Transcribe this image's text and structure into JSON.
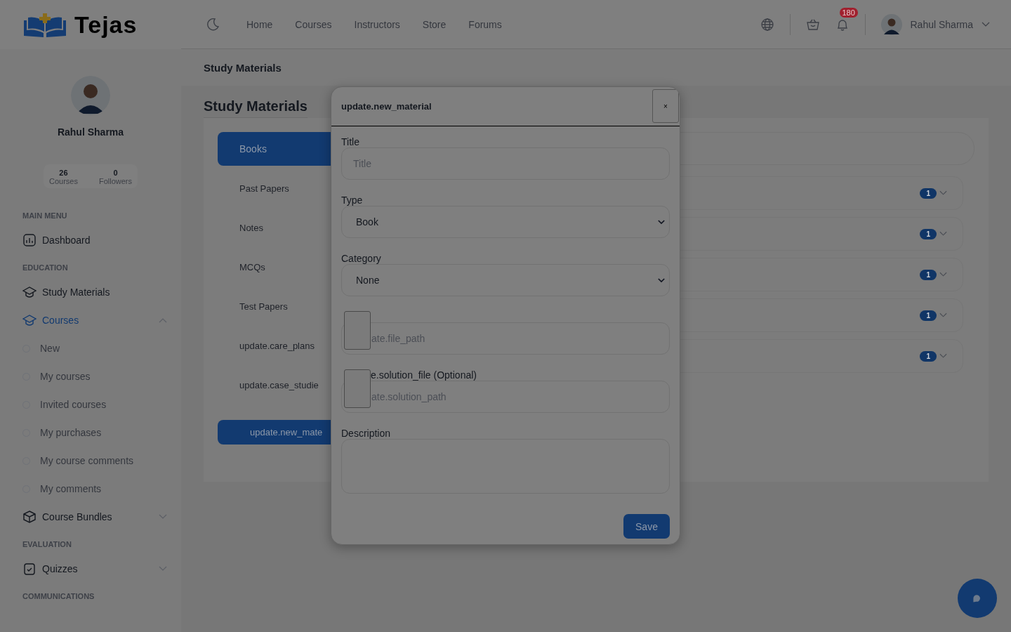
{
  "brand": {
    "name": "Tejas"
  },
  "nav": [
    {
      "label": "Home"
    },
    {
      "label": "Courses"
    },
    {
      "label": "Instructors"
    },
    {
      "label": "Store"
    },
    {
      "label": "Forums"
    }
  ],
  "header": {
    "notification_count": "180",
    "user_name": "Rahul Sharma"
  },
  "profile": {
    "name": "Rahul Sharma",
    "stats": [
      {
        "value": "26",
        "label": "Courses"
      },
      {
        "value": "0",
        "label": "Followers"
      }
    ]
  },
  "sidebar": {
    "sections": [
      {
        "heading": "MAIN MENU",
        "items": [
          {
            "label": "Dashboard",
            "selected": false
          }
        ]
      },
      {
        "heading": "EDUCATION",
        "items": [
          {
            "label": "Study Materials",
            "selected": false
          },
          {
            "label": "Courses",
            "selected": true,
            "expanded": true,
            "children": [
              {
                "label": "New"
              },
              {
                "label": "My courses"
              },
              {
                "label": "Invited courses"
              },
              {
                "label": "My purchases"
              },
              {
                "label": "My course comments"
              },
              {
                "label": "My comments"
              }
            ]
          },
          {
            "label": "Course Bundles",
            "selected": false,
            "expanded": false
          }
        ]
      },
      {
        "heading": "EVALUATION",
        "items": [
          {
            "label": "Quizzes",
            "selected": false,
            "expanded": false
          }
        ]
      },
      {
        "heading": "COMMUNICATIONS"
      }
    ]
  },
  "breadcrumb": "Study Materials",
  "page_title": "Study Materials",
  "tabs": [
    {
      "label": "Books",
      "selected": true
    },
    {
      "label": "Past Papers",
      "selected": false
    },
    {
      "label": "Notes",
      "selected": false
    },
    {
      "label": "MCQs",
      "selected": false
    },
    {
      "label": "Test Papers",
      "selected": false
    },
    {
      "label": "update.care_plans",
      "selected": false
    },
    {
      "label": "update.case_studie",
      "selected": false
    }
  ],
  "new_button": "update.new_mate",
  "accordions": [
    {
      "badge": "1",
      "expanded": false
    },
    {
      "badge": "1",
      "expanded": false
    },
    {
      "badge": "1",
      "expanded": false
    },
    {
      "badge": "1",
      "expanded": false
    },
    {
      "badge": "1",
      "expanded": false
    }
  ],
  "modal": {
    "title": "update.new_material",
    "close": "×",
    "fields": [
      {
        "kind": "text",
        "label": "Title",
        "placeholder": "Title"
      },
      {
        "kind": "select",
        "label": "Type",
        "value": "Book"
      },
      {
        "kind": "select",
        "label": "Category",
        "value": "None"
      },
      {
        "kind": "file",
        "placeholder": "ate.file_path"
      },
      {
        "kind": "file",
        "label": "e.solution_file (Optional)",
        "placeholder": "ate.solution_path"
      },
      {
        "kind": "textarea",
        "label": "Description"
      }
    ],
    "save": "Save"
  }
}
